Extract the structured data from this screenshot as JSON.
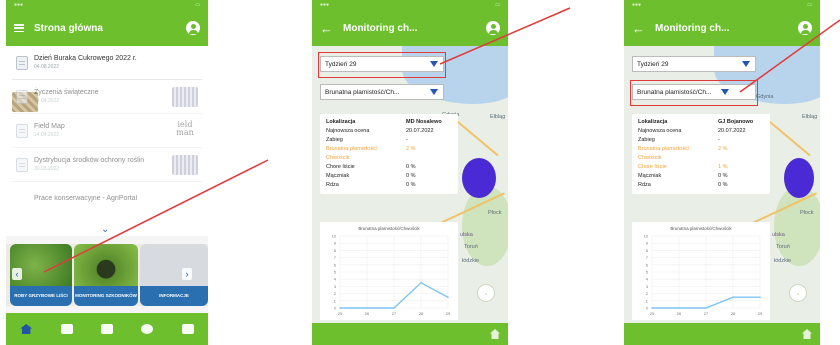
{
  "screen1": {
    "title": "Strona główna",
    "news": [
      {
        "title": "Dzień Buraka Cukrowego 2022 r.",
        "date": "04.08.2022",
        "thumb": "map"
      },
      {
        "title": "Życzenia świąteczne",
        "date": "14.04.2022",
        "thumb": "gray"
      },
      {
        "title": "Field Map",
        "date": "14.04.2022",
        "thumb": "text",
        "thumb_text": "ield man"
      },
      {
        "title": "Dystrybucja środków ochrony roślin",
        "date": "30.03.2022",
        "thumb": "gray"
      },
      {
        "title": "Prace konserwacyjne - AgriPortal",
        "date": "",
        "thumb": ""
      }
    ],
    "cards": [
      "ROBY GRZYBOWE LIŚCI",
      "MONITORING SZKODNIKÓW",
      "INFORMACJE"
    ],
    "nav": [
      "home",
      "calendar",
      "calculator",
      "people",
      "farm"
    ]
  },
  "screen2": {
    "title": "Monitoring ch...",
    "week_select": "Tydzień 29",
    "disease_select": "Brunatna plamistość/Ch...",
    "map_labels": [
      "Gdynia",
      "Elbląg",
      "Płock",
      "ulska",
      "Toruń",
      "łódzkie"
    ],
    "info": {
      "headers": [
        "Lokalizacja",
        "MD Nosalewo"
      ],
      "rows": [
        {
          "label": "Najnowsza ocena",
          "value": "20.07.2022",
          "highlight": false
        },
        {
          "label": "Zabieg",
          "value": "-",
          "highlight": false
        },
        {
          "label": "Brunatna plamistość/ Chwościk",
          "value": "2 %",
          "highlight": true
        },
        {
          "label": "Chore liście",
          "value": "0 %",
          "highlight": false
        },
        {
          "label": "Mączniak",
          "value": "0 %",
          "highlight": false
        },
        {
          "label": "Rdza",
          "value": "0 %",
          "highlight": false
        }
      ]
    },
    "chart_data": {
      "type": "line",
      "title": "Brunatna plamistość/Chwościk",
      "x": [
        25,
        26,
        27,
        28,
        29
      ],
      "y": [
        0,
        0,
        0,
        3.5,
        1.5
      ],
      "ylim": [
        0,
        10
      ],
      "yticks": [
        0,
        1,
        2,
        3,
        4,
        5,
        6,
        7,
        8,
        9,
        10
      ],
      "color": "#7fc4f2"
    }
  },
  "screen3": {
    "title": "Monitoring ch...",
    "week_select": "Tydzień 29",
    "disease_select": "Brunatna plamistość/Ch...",
    "map_labels": [
      "Gdynia",
      "Elbląg",
      "Płock",
      "ulska",
      "Toruń",
      "łódzkie"
    ],
    "info": {
      "headers": [
        "Lokalizacja",
        "GJ Bojanowo"
      ],
      "rows": [
        {
          "label": "Najnowsza ocena",
          "value": "20.07.2022",
          "highlight": false
        },
        {
          "label": "Zabieg",
          "value": "-",
          "highlight": false
        },
        {
          "label": "Brunatna plamistość/ Chwościk",
          "value": "2 %",
          "highlight": true
        },
        {
          "label": "Chore liście",
          "value": "1 %",
          "highlight": true
        },
        {
          "label": "Mączniak",
          "value": "0 %",
          "highlight": false
        },
        {
          "label": "Rdza",
          "value": "0 %",
          "highlight": false
        }
      ]
    },
    "chart_data": {
      "type": "line",
      "title": "Brunatna plamistość/Chwościk",
      "x": [
        25,
        26,
        27,
        28,
        29
      ],
      "y": [
        0,
        0,
        0,
        1.5,
        1.5
      ],
      "ylim": [
        0,
        10
      ],
      "yticks": [
        0,
        1,
        2,
        3,
        4,
        5,
        6,
        7,
        8,
        9,
        10
      ],
      "color": "#7fc4f2"
    }
  },
  "colors": {
    "brand_green": "#6dbf2e",
    "annotation_red": "#e23a3a",
    "caret_blue": "#2455b5",
    "highlight_orange": "#f2a33a"
  }
}
